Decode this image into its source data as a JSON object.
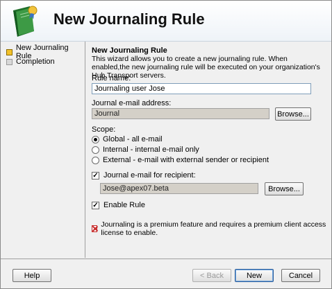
{
  "header": {
    "title": "New Journaling Rule",
    "icon": "journal-book-icon",
    "icon_color": "#2f7d32"
  },
  "nav": {
    "items": [
      {
        "label": "New Journaling Rule",
        "active": true
      },
      {
        "label": "Completion",
        "active": false
      }
    ]
  },
  "content": {
    "section_title": "New Journaling Rule",
    "description": "This wizard allows you to create a new journaling rule. When enabled,the new journaling rule will be executed on your organization's Hub Transport servers.",
    "rule_name_label": "Rule name:",
    "rule_name_value": "Journaling user Jose",
    "journal_email_label": "Journal e-mail address:",
    "journal_email_value": "Journal",
    "browse_label": "Browse...",
    "scope_label": "Scope:",
    "scope_options": [
      {
        "label": "Global - all e-mail",
        "selected": true
      },
      {
        "label": "Internal - internal e-mail only",
        "selected": false
      },
      {
        "label": "External - e-mail with external sender or recipient",
        "selected": false
      }
    ],
    "journal_recipient_label": "Journal e-mail for recipient:",
    "journal_recipient_checked": true,
    "recipient_value": "Jose@apex07.beta",
    "browse2_label": "Browse...",
    "enable_rule_label": "Enable Rule",
    "enable_rule_checked": true,
    "warning_text": "Journaling is a premium feature and requires a premium client access license to enable."
  },
  "footer": {
    "help": "Help",
    "back": "< Back",
    "next": "New",
    "cancel": "Cancel"
  },
  "colors": {
    "accent": "#f3c22a",
    "warning": "#c62828"
  }
}
